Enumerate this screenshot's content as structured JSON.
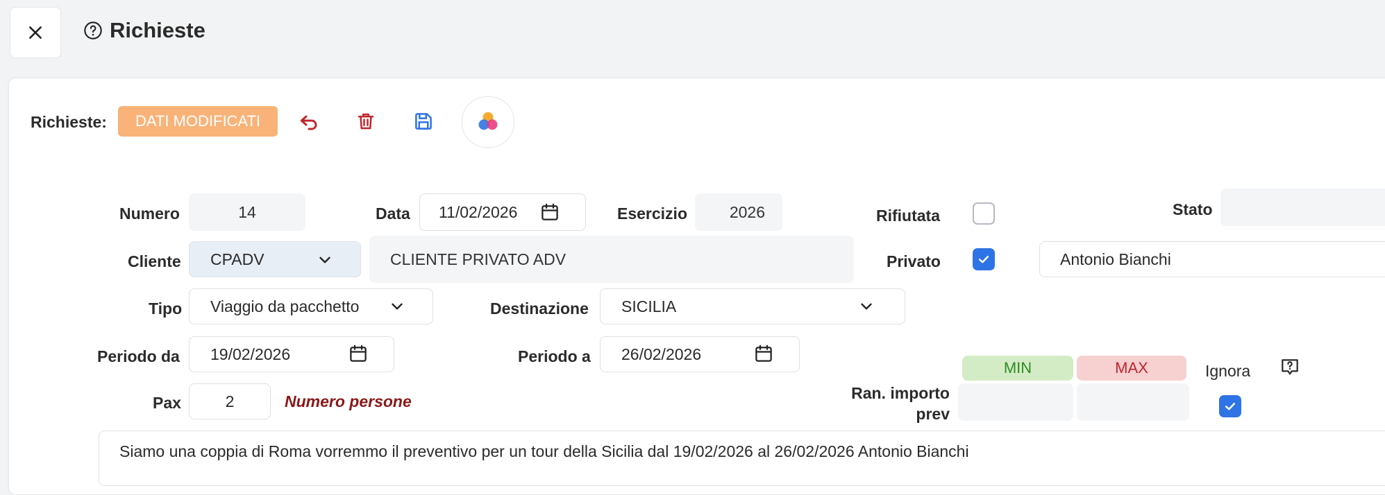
{
  "window": {
    "title": "Richieste"
  },
  "toolbar": {
    "label": "Richieste:",
    "status_badge": "DATI MODIFICATI",
    "badge_color": "#f9b378"
  },
  "form": {
    "numero": {
      "label": "Numero",
      "value": "14"
    },
    "data": {
      "label": "Data",
      "value": "11/02/2026"
    },
    "esercizio": {
      "label": "Esercizio",
      "value": "2026"
    },
    "rifiutata": {
      "label": "Rifiutata",
      "checked": false
    },
    "stato": {
      "label": "Stato",
      "value": ""
    },
    "cliente": {
      "label": "Cliente",
      "code": "CPADV",
      "name": "CLIENTE PRIVATO ADV"
    },
    "privato": {
      "label": "Privato",
      "checked": true,
      "name": "Antonio Bianchi"
    },
    "tipo": {
      "label": "Tipo",
      "value": "Viaggio da pacchetto"
    },
    "destinazione": {
      "label": "Destinazione",
      "value": "SICILIA"
    },
    "periodo_da": {
      "label": "Periodo da",
      "value": "19/02/2026"
    },
    "periodo_a": {
      "label": "Periodo a",
      "value": "26/02/2026"
    },
    "pax": {
      "label": "Pax",
      "value": "2",
      "note": "Numero persone"
    },
    "range": {
      "label_line1": "Ran. importo",
      "label_line2": "prev",
      "min_label": "MIN",
      "max_label": "MAX",
      "min_value": "",
      "max_value": ""
    },
    "ignora": {
      "label": "Ignora",
      "checked": true
    },
    "note_text": "Siamo una coppia di Roma vorremmo il preventivo per un tour della Sicilia dal 19/02/2026 al 26/02/2026 Antonio Bianchi"
  },
  "icons": {
    "close": "close-icon",
    "help": "help-circle-icon",
    "undo": "undo-icon",
    "delete": "trash-icon",
    "save": "floppy-disk-icon",
    "colors": "color-palette-icon",
    "calendar": "calendar-icon",
    "chevron": "chevron-down-icon",
    "help_bubble": "help-bubble-icon"
  },
  "colors": {
    "accent_blue": "#2f74e6",
    "delete_red": "#c0262d",
    "note_red": "#8b1818",
    "min_bg": "#d4ecc6",
    "max_bg": "#f7d0d0"
  }
}
